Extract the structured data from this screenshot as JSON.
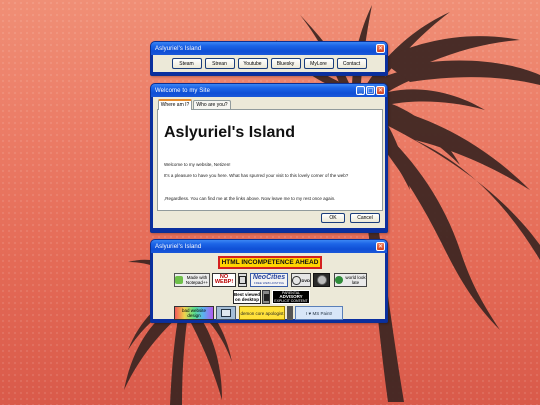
{
  "win1": {
    "title": "Aslyuriel's Island",
    "links": [
      "Steam",
      "Strean",
      "Youtube",
      "Bluesky",
      "MyLore",
      "Contact"
    ]
  },
  "win2": {
    "title": "Welcome to my Site",
    "tabs": [
      "Where am I?",
      "Who are you?"
    ],
    "heading": "Aslyuriel's Island",
    "lines": [
      "Welcome to my website, Netizen!",
      "It's a pleasure to have you here. What has spurred your visit to this lovely corner of the web?",
      ",Regardless. You can find me at the links above. Now leave me to my rest once again."
    ],
    "ok_label": "OK",
    "cancel_label": "Cancel"
  },
  "win3": {
    "title": "Aslyuriel's Island",
    "banner": "HTML INCOMPETENCE AHEAD",
    "buttons": {
      "notepad": "Made with Notepad++",
      "nowebp": "NO WEBP!",
      "neocities_top": "NeoCities",
      "neocities_sub": "FREE WEB HOSTING",
      "dvd": "DVD",
      "wwlook": "world look late",
      "bestviewed": "Best viewed on desktop",
      "advisory_top": "PARENTAL",
      "advisory_mid": "ADVISORY",
      "advisory_sub": "EXPLICIT CONTENT",
      "baddesign": "bad website design",
      "demoncore": "demon core apologist",
      "paint": "I ♥ MS Paint!"
    }
  },
  "colors": {
    "bg_top": "#f08f76",
    "bg_bottom": "#d95a4a",
    "palm": "#3b2420",
    "xp_blue": "#0f4fd6",
    "xp_face": "#ece9d8"
  },
  "icons": [
    "close-icon",
    "minimize-icon",
    "maximize-icon",
    "palm-tree-silhouette"
  ]
}
